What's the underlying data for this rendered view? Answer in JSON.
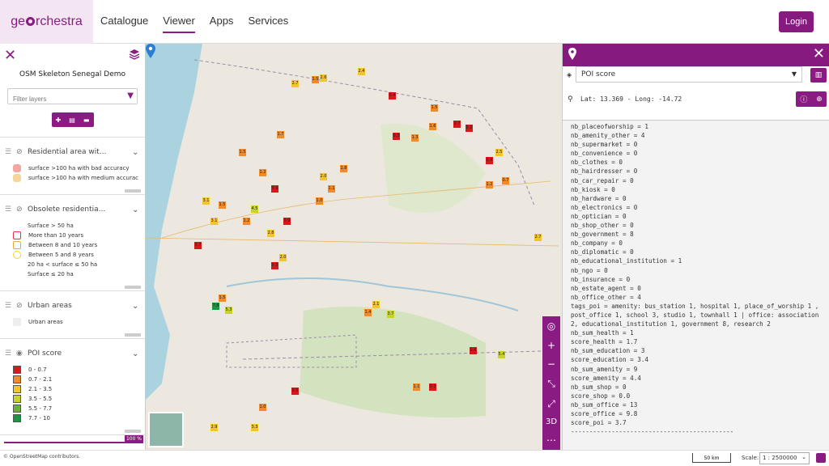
{
  "header": {
    "logo": {
      "prefix": "ge",
      "suffix": "rchestra"
    },
    "nav": [
      {
        "label": "Catalogue",
        "active": false
      },
      {
        "label": "Viewer",
        "active": true
      },
      {
        "label": "Apps",
        "active": false
      },
      {
        "label": "Services",
        "active": false
      }
    ],
    "login_label": "Login"
  },
  "sidebar": {
    "title": "OSM Skeleton Senegal Demo",
    "filter_placeholder": "Filter layers",
    "layers": [
      {
        "name": "Residential area wit...",
        "legend": [
          {
            "label": "surface >100 ha with bad accuracy",
            "color": "#f4a6a0",
            "shape": "pentagon"
          },
          {
            "label": "surface >100 ha with medium accurac",
            "color": "#f6d59b",
            "shape": "hexagon"
          }
        ]
      },
      {
        "name": "Obsolete residentia...",
        "legend": [
          {
            "label": "Surface > 50 ha",
            "color": "",
            "shape": "none"
          },
          {
            "label": "More than 10 years",
            "color": "#e0364d",
            "shape": "pentagon-outline"
          },
          {
            "label": "Between 8 and 10 years",
            "color": "#f0a13a",
            "shape": "hexagon-outline"
          },
          {
            "label": "Between 5 and 8 years",
            "color": "#f2d53a",
            "shape": "circle-outline"
          },
          {
            "label": "20 ha < surface ≤ 50 ha",
            "color": "",
            "shape": "none"
          },
          {
            "label": "Surface ≤ 20 ha",
            "color": "",
            "shape": "none"
          }
        ]
      },
      {
        "name": "Urban areas",
        "legend": [
          {
            "label": "Urban areas",
            "color": "#eeeeee",
            "shape": "square"
          }
        ]
      },
      {
        "name": "POI score",
        "visible": true,
        "legend": [
          {
            "label": "0 - 0.7",
            "color": "#d7191c"
          },
          {
            "label": "0.7 - 2.1",
            "color": "#f08a2a"
          },
          {
            "label": "2.1 - 3.5",
            "color": "#f4c430"
          },
          {
            "label": "3.5 - 5.5",
            "color": "#c7d32a"
          },
          {
            "label": "5.5 - 7.7",
            "color": "#6ab03a"
          },
          {
            "label": "7.7 - 10",
            "color": "#1a9641"
          }
        ],
        "opacity": "100 %"
      }
    ]
  },
  "map": {
    "cells": [
      [
        "2.7",
        "#f4c430"
      ],
      [
        "1.5",
        "#f08a2a"
      ],
      [
        "2.6",
        "#f4c430"
      ],
      [
        "2.4",
        "#f4c430"
      ],
      [
        "0.4",
        "#d7191c"
      ],
      [
        "1.5",
        "#f08a2a"
      ],
      [
        "1.6",
        "#f08a2a"
      ],
      [
        "0.7",
        "#d7191c"
      ],
      [
        "0.2",
        "#d7191c"
      ],
      [
        "0.3",
        "#d7191c"
      ],
      [
        "1.3",
        "#f08a2a"
      ],
      [
        "1.7",
        "#f08a2a"
      ],
      [
        "1.2",
        "#f08a2a"
      ],
      [
        "0.9",
        "#d7191c"
      ],
      [
        "2.5",
        "#f4c430"
      ],
      [
        "0.4",
        "#d7191c"
      ],
      [
        "1.5",
        "#f08a2a"
      ],
      [
        "2.0",
        "#f4c430"
      ],
      [
        "1.1",
        "#f08a2a"
      ],
      [
        "1.5",
        "#f08a2a"
      ],
      [
        "3.1",
        "#f4c430"
      ],
      [
        "0.7",
        "#f08a2a"
      ],
      [
        "1.2",
        "#f08a2a"
      ],
      [
        "2.7",
        "#f4c430"
      ],
      [
        "3.1",
        "#f4c430"
      ],
      [
        "4.5",
        "#c7d32a"
      ],
      [
        "1.2",
        "#f08a2a"
      ],
      [
        "0.9",
        "#d7191c"
      ],
      [
        "2.8",
        "#f4c430"
      ],
      [
        "1.8",
        "#f08a2a"
      ],
      [
        "1.0",
        "#f08a2a"
      ],
      [
        "0.7",
        "#d7191c"
      ],
      [
        "2.0",
        "#f4c430"
      ],
      [
        "0.3",
        "#d7191c"
      ],
      [
        "2.1",
        "#f4c430"
      ],
      [
        "1.4",
        "#f08a2a"
      ],
      [
        "3.7",
        "#c7d32a"
      ],
      [
        "5.3",
        "#c7d32a"
      ],
      [
        "7.8",
        "#1a9641"
      ],
      [
        "1.5",
        "#f08a2a"
      ],
      [
        "5.4",
        "#c7d32a"
      ],
      [
        "0.6",
        "#d7191c"
      ],
      [
        "2.9",
        "#f4c430"
      ],
      [
        "3.3",
        "#f4c430"
      ],
      [
        "1.0",
        "#f08a2a"
      ],
      [
        "0.5",
        "#d7191c"
      ],
      [
        "1.1",
        "#f08a2a"
      ],
      [
        "0.3",
        "#d7191c"
      ]
    ],
    "tools": [
      "locate",
      "zoom-in",
      "zoom-out",
      "fit",
      "fullscreen",
      "3D",
      "more"
    ],
    "tool_3d_label": "3D"
  },
  "panel": {
    "layer_select": "POI score",
    "coordinates": "Lat: 13.369 - Long: -14.72",
    "attributes": [
      "nb_placeofworship = 1",
      "nb_amenity_other = 4",
      "nb_supermarket = 0",
      "nb_convenience = 0",
      "nb_clothes = 0",
      "nb_hairdresser = 0",
      "nb_car_repair = 0",
      "nb_kiosk = 0",
      "nb_hardware = 0",
      "nb_electronics = 0",
      "nb_optician = 0",
      "nb_shop_other = 0",
      "nb_government = 8",
      "nb_company = 0",
      "nb_diplomatic = 0",
      "nb_educational_institution = 1",
      "nb_ngo = 0",
      "nb_insurance = 0",
      "nb_estate_agent = 0",
      "nb_office_other = 4",
      "tags_poi = amenity: bus_station 1, hospital 1, place_of_worship 1 , post_office 1, school 3, studio 1, townhall 1 | office: association 2, educational_institution 1, government 8, research 2",
      "nb_sum_health = 1",
      "score_health = 1.7",
      "nb_sum_education = 3",
      "score_education = 3.4",
      "nb_sum_amenity = 9",
      "score_amenity = 4.4",
      "nb_sum_shop = 0",
      "score_shop = 0.0",
      "nb_sum_office = 13",
      "score_office = 9.8",
      "score_poi = 3.7",
      "--------------------------------------------"
    ]
  },
  "footer": {
    "attribution": "© OpenStreetMap contributors.",
    "scalebar": "50 km",
    "scale_label": "Scale:",
    "scale_value": "1 : 2500000"
  }
}
